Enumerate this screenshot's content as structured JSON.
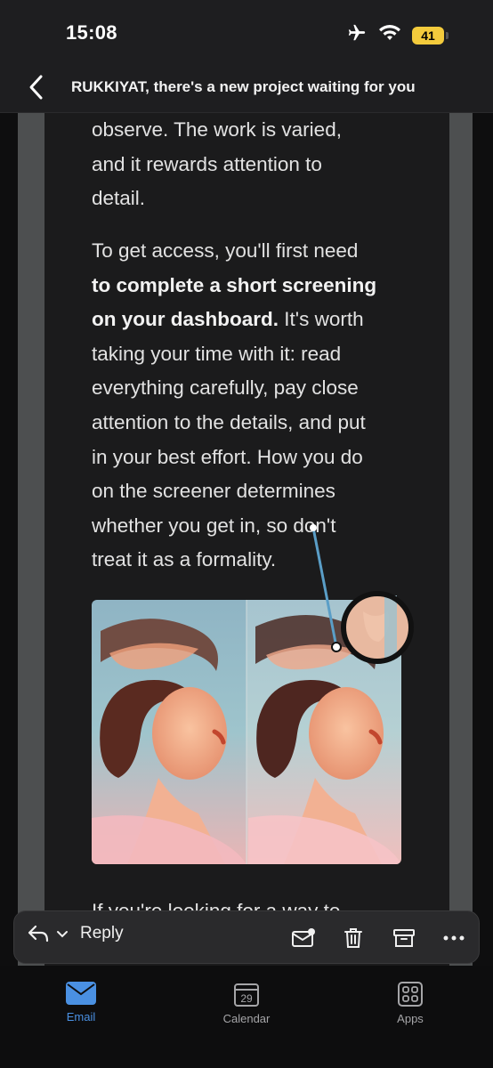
{
  "status": {
    "time": "15:08",
    "battery": "41"
  },
  "header": {
    "title": "RUKKIYAT, there's a new project waiting for you"
  },
  "email": {
    "p1_lines": [
      "observe. The work is varied,",
      "and it rewards attention to",
      "detail."
    ],
    "p2_lines": [
      "To get access, you'll first need",
      "to complete a short screening",
      "on your dashboard.",
      " It's worth",
      "taking your time with it: read",
      "everything carefully, pay close",
      "attention to the details, and put",
      "in your best effort. How you do",
      "on the screener determines",
      "whether you get in, so don't",
      "treat it as a formality."
    ],
    "p3_line": "If you're looking for a way to"
  },
  "actions": {
    "reply_label": "Reply"
  },
  "tabs": [
    {
      "label": "Email",
      "icon": "mail-icon",
      "active": true
    },
    {
      "label": "Calendar",
      "icon": "calendar-icon",
      "date": "29"
    },
    {
      "label": "Apps",
      "icon": "apps-grid-icon"
    }
  ],
  "colors": {
    "accent": "#4a90e2",
    "battery": "#f4cb3c",
    "card": "#1b1b1c"
  }
}
